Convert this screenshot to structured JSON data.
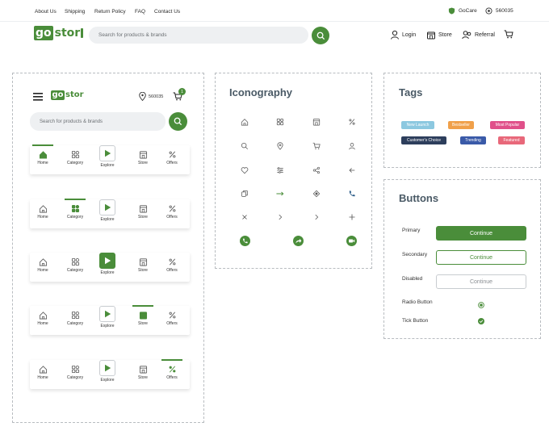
{
  "topbar": {
    "links": [
      "About Us",
      "Shipping",
      "Return Policy",
      "FAQ",
      "Contact Us"
    ],
    "gocare": "GoCare",
    "pincode": "560035"
  },
  "brand": {
    "logo_main": "go",
    "logo_rest": "stor",
    "color": "#4a8d3a"
  },
  "header": {
    "search_placeholder": "Search for products & brands",
    "nav": {
      "login": "Login",
      "store": "Store",
      "referral": "Referral"
    }
  },
  "mobile": {
    "pincode": "560035",
    "cart_count": "1",
    "search_placeholder": "Search for products & brands",
    "nav_labels": [
      "Home",
      "Category",
      "Explore",
      "Store",
      "Offers"
    ],
    "active_tabs": [
      "Home",
      "Category",
      "Explore",
      "Store",
      "Offers"
    ]
  },
  "iconography": {
    "title": "Iconography",
    "icons": [
      "home-icon",
      "category-icon",
      "store-icon",
      "offers-icon",
      "search-icon",
      "location-icon",
      "cart-icon",
      "user-icon",
      "heart-icon",
      "filter-icon",
      "share-icon",
      "arrow-left-icon",
      "copy-icon",
      "arrow-right-long-icon",
      "diamond-icon",
      "phone-icon",
      "close-icon",
      "chevron-right-icon",
      "chevron-right-icon",
      "plus-icon",
      "call-circle-icon",
      "forward-circle-icon",
      "video-circle-icon"
    ]
  },
  "tags": {
    "title": "Tags",
    "items": [
      {
        "label": "New Launch",
        "color": "#8cc8e0"
      },
      {
        "label": "Bestseller",
        "color": "#f0a04a"
      },
      {
        "label": "Most Popular",
        "color": "#e0508a"
      },
      {
        "label": "Customer's Choice",
        "color": "#2d3e5c"
      },
      {
        "label": "Trending",
        "color": "#3a5aa8"
      },
      {
        "label": "Featured",
        "color": "#e8687a"
      }
    ]
  },
  "buttons": {
    "title": "Buttons",
    "rows": [
      {
        "label": "Primary",
        "button": "Continue"
      },
      {
        "label": "Secondary",
        "button": "Continue"
      },
      {
        "label": "Disabled",
        "button": "Continue"
      },
      {
        "label": "Radio Button"
      },
      {
        "label": "Tick Button"
      }
    ]
  }
}
